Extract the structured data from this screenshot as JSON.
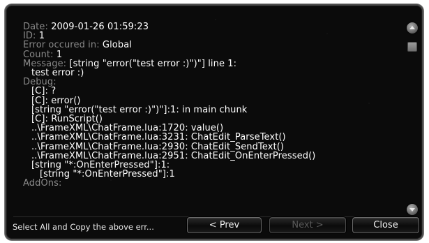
{
  "error": {
    "date_label": "Date:",
    "date_value": "2009-01-26 01:59:23",
    "id_label": "ID:",
    "id_value": "1",
    "location_label": "Error occured in:",
    "location_value": "Global",
    "count_label": "Count:",
    "count_value": "1",
    "message_label": "Message:",
    "message_value": "[string \"error(\"test error :)\")\"] line 1:",
    "message_detail": "test error :)",
    "debug_label": "Debug:",
    "debug_lines": [
      "[C]: ?",
      "[C]: error()",
      "[string \"error(\"test error :)\")\"]:1: in main chunk",
      "[C]: RunScript()",
      "..\\FrameXML\\ChatFrame.lua:1720: value()",
      "..\\FrameXML\\ChatFrame.lua:3231: ChatEdit_ParseText()",
      "..\\FrameXML\\ChatFrame.lua:2930: ChatEdit_SendText()",
      "..\\FrameXML\\ChatFrame.lua:2951: ChatEdit_OnEnterPressed()",
      "[string \"*:OnEnterPressed\"]:1:",
      "[string \"*:OnEnterPressed\"]:1"
    ],
    "addons_label": "AddOns:"
  },
  "footer": {
    "status_text": "Select All and Copy the above err...",
    "prev_label": "< Prev",
    "next_label": "Next >",
    "close_label": "Close"
  },
  "icons": {
    "scroll_up": "scroll-up-arrow-icon",
    "scroll_down": "scroll-down-arrow-icon"
  },
  "colors": {
    "background": "#0b0b0b",
    "label": "#8a8a8a",
    "value": "#ffffff",
    "disabled": "#5a5a5a"
  }
}
